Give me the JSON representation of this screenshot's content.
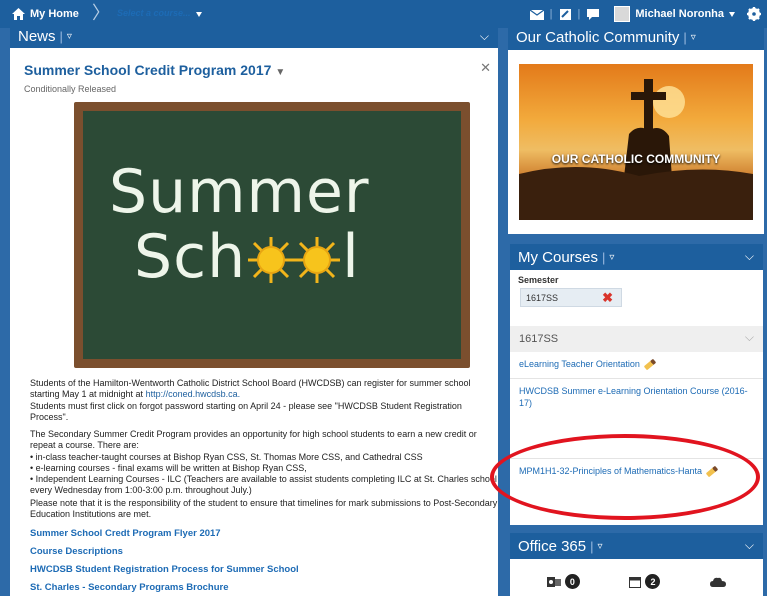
{
  "topbar": {
    "home_label": "My Home",
    "course_select": "Select a course...",
    "user_name": "Michael Noronha",
    "icons": [
      "mail-icon",
      "update-icon",
      "chat-icon",
      "gear-icon"
    ]
  },
  "news": {
    "widget_title": "News",
    "article_title": "Summer School Credit Program 2017",
    "status": "Conditionally Released",
    "board_line1": "Summer",
    "board_line2": "Sch",
    "board_line2_end": "l",
    "p1_before": "Students of the Hamilton-Wentworth Catholic District School Board (HWCDSB) can register for summer school starting May 1 at midnight at",
    "p1_link": "http://coned.hwcdsb.ca.",
    "p1_after": "Students must first click on forgot password starting on April 24 - please see \"HWCDSB Student Registration Process\".",
    "p2_intro": "The Secondary Summer Credit Program provides an opportunity for high school students to earn a new credit or repeat a course. There are:",
    "bullets": [
      "• in-class teacher-taught courses at Bishop Ryan CSS, St. Thomas More CSS, and Cathedral CSS",
      "• e-learning courses - final exams will be written at Bishop Ryan CSS,",
      "• Independent Learning Courses - ILC (Teachers are available to assist students completing ILC at St. Charles school every Wednesday from 1:00-3:00 p.m. throughout July.)"
    ],
    "p3": "Please note that it is the responsibility of the student to ensure that timelines for mark submissions to Post-Secondary Education Institutions are met.",
    "links": [
      "Summer School Credt Program Flyer 2017",
      "Course Descriptions",
      "HWCDSB Student Registration Process for Summer School",
      "St. Charles - Secondary Programs Brochure"
    ]
  },
  "community": {
    "widget_title": "Our Catholic Community",
    "image_text": "OUR CATHOLIC COMMUNITY"
  },
  "courses": {
    "widget_title": "My Courses",
    "semester_label": "Semester",
    "semester_value": "1617SS",
    "group_heading": "1617SS",
    "items": [
      "eLearning Teacher Orientation",
      "HWCDSB Summer e-Learning Orientation Course (2016-17)",
      "MPM1H1-32-Principles of Mathematics-Hanta"
    ]
  },
  "office": {
    "widget_title": "Office 365",
    "mail_count": "0",
    "calendar_count": "2"
  },
  "colors": {
    "brand": "#1d5f9e",
    "link": "#1d6bb5",
    "annotation": "#e1141f"
  }
}
